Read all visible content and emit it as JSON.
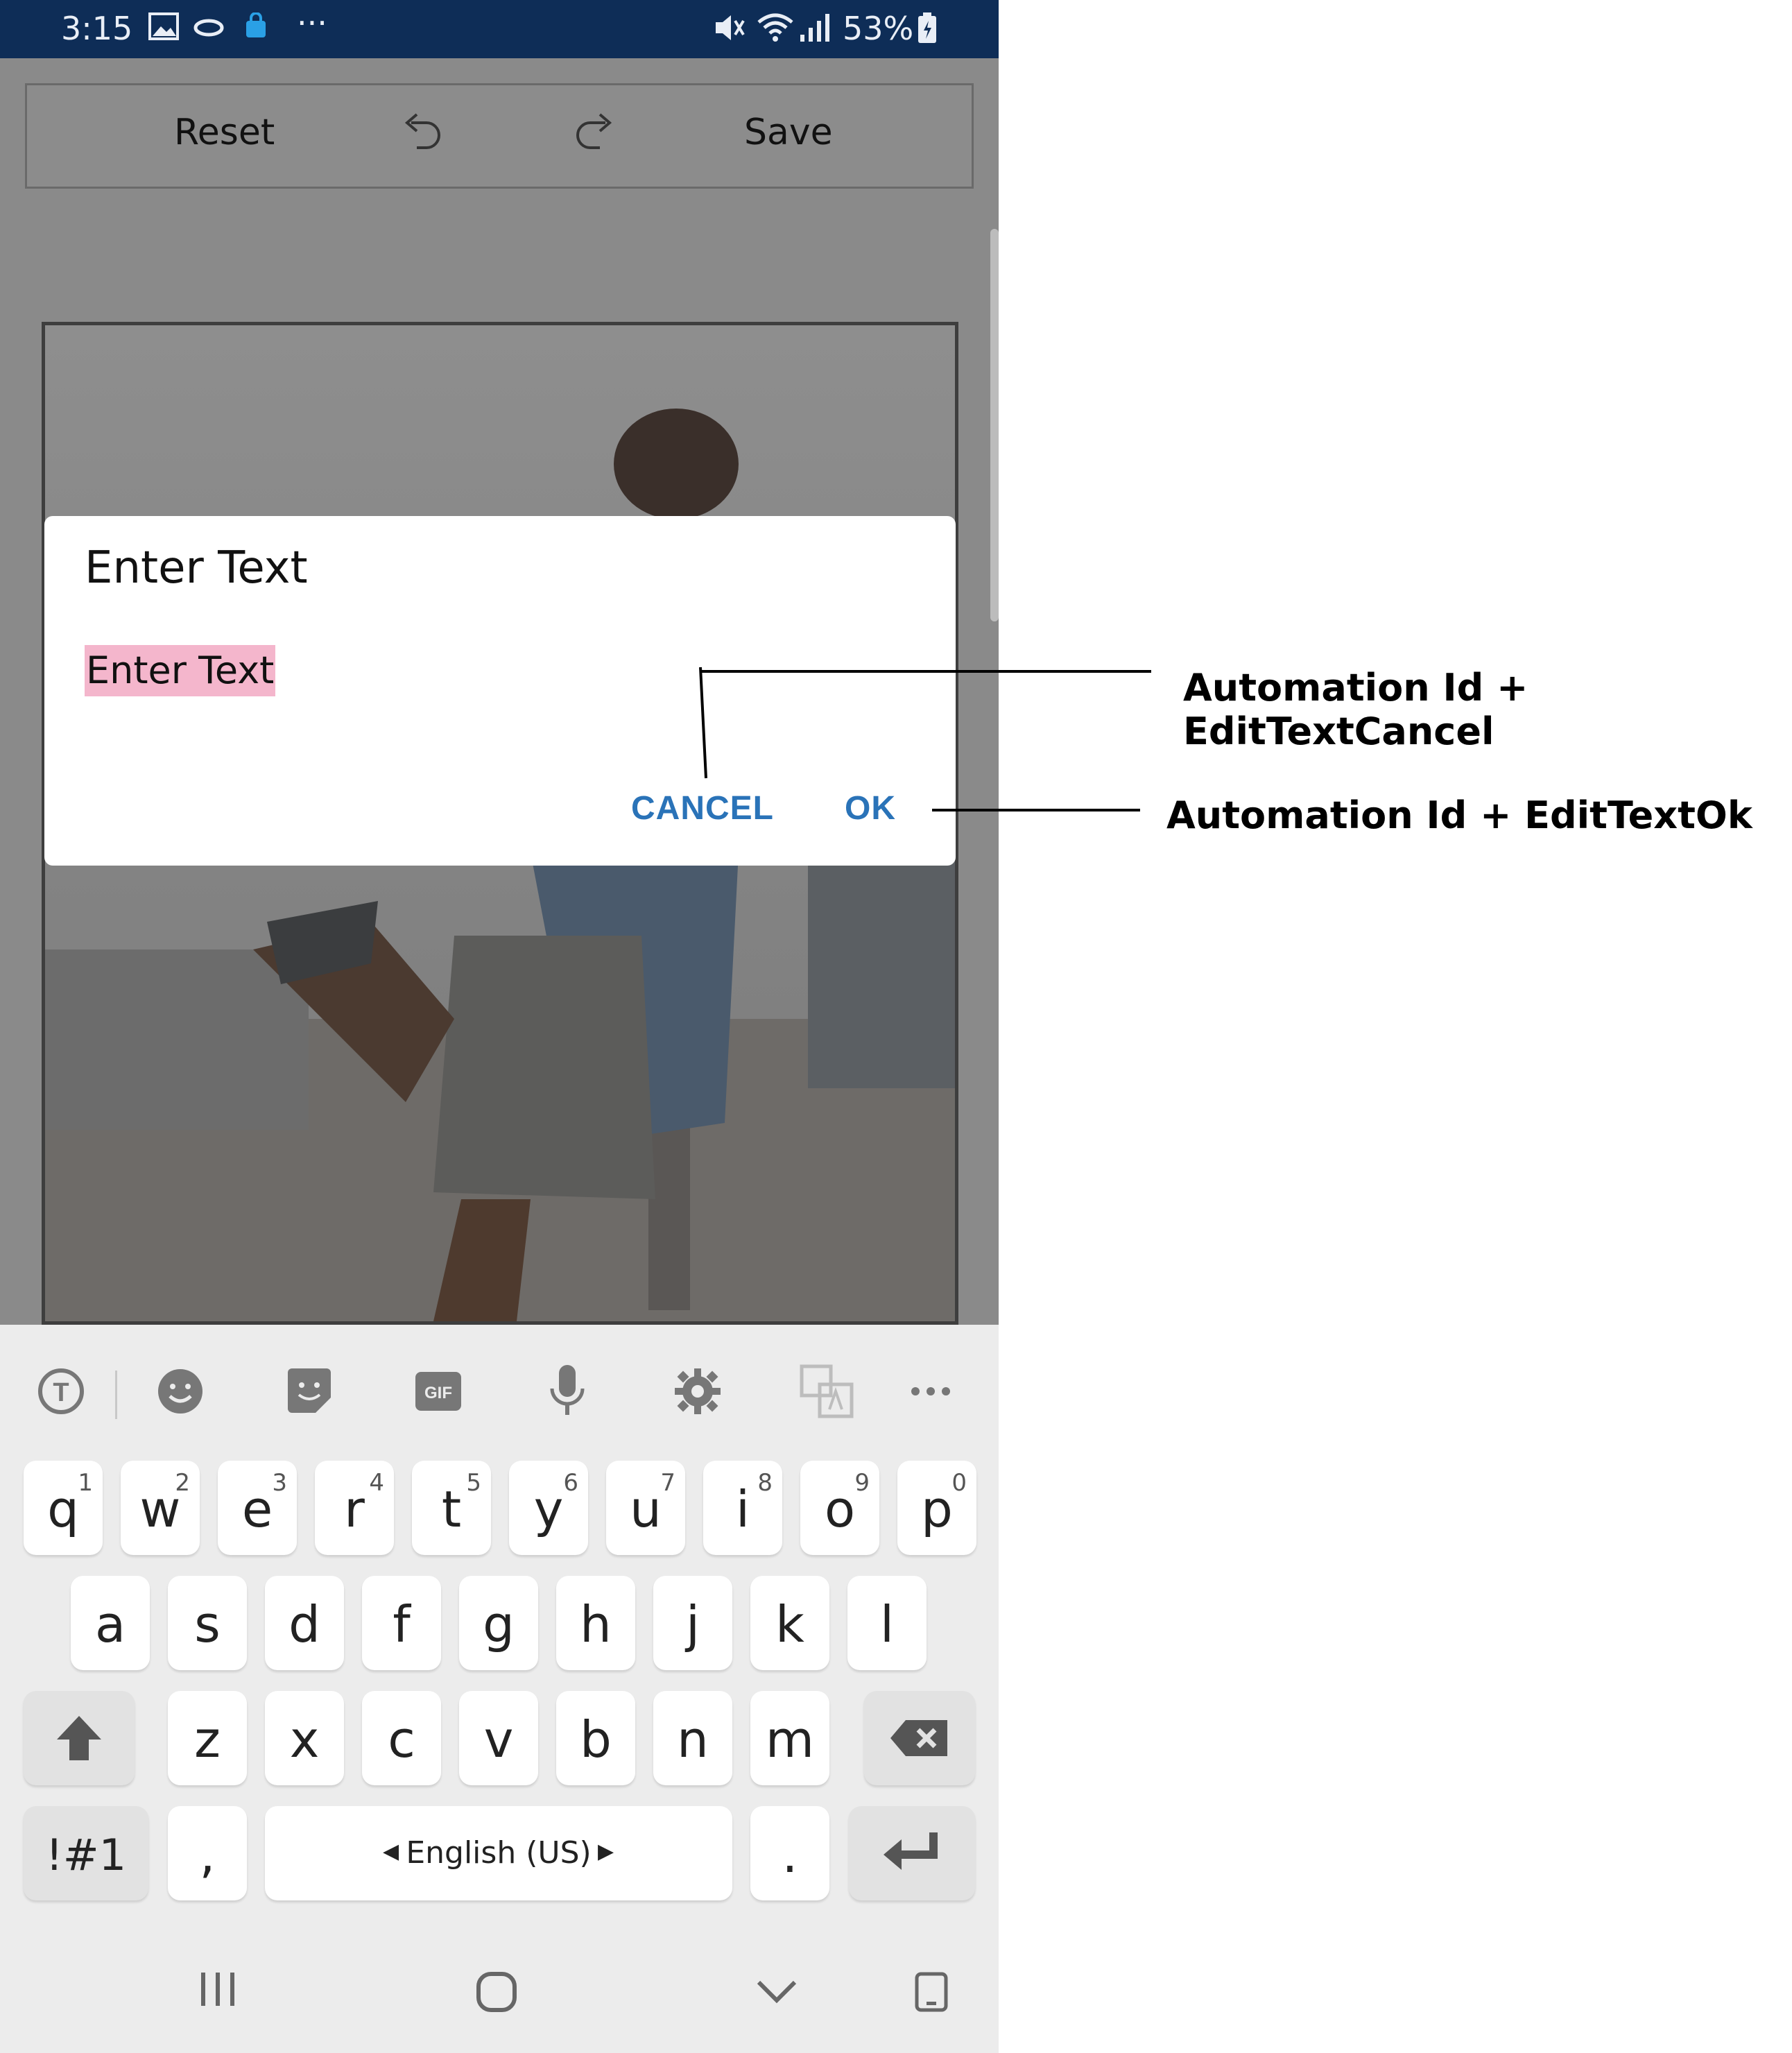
{
  "status_bar": {
    "time": "3:15",
    "more": "···",
    "battery": "53%"
  },
  "toolbar": {
    "reset_label": "Reset",
    "save_label": "Save"
  },
  "dialog": {
    "title": "Enter Text",
    "input_value": "Enter Text",
    "cancel_label": "CANCEL",
    "ok_label": "OK"
  },
  "annotations": {
    "cancel_note": "Automation Id + EditTextCancel",
    "ok_note": "Automation Id + EditTextOk"
  },
  "keyboard": {
    "toolbar_icons": [
      "text-recognition-icon",
      "emoji-icon",
      "sticker-icon",
      "gif-icon",
      "microphone-icon",
      "settings-icon",
      "translate-icon",
      "more-icon"
    ],
    "gif_label": "GIF",
    "row1": [
      {
        "key": "q",
        "num": "1"
      },
      {
        "key": "w",
        "num": "2"
      },
      {
        "key": "e",
        "num": "3"
      },
      {
        "key": "r",
        "num": "4"
      },
      {
        "key": "t",
        "num": "5"
      },
      {
        "key": "y",
        "num": "6"
      },
      {
        "key": "u",
        "num": "7"
      },
      {
        "key": "i",
        "num": "8"
      },
      {
        "key": "o",
        "num": "9"
      },
      {
        "key": "p",
        "num": "0"
      }
    ],
    "row2": [
      "a",
      "s",
      "d",
      "f",
      "g",
      "h",
      "j",
      "k",
      "l"
    ],
    "row3": [
      "z",
      "x",
      "c",
      "v",
      "b",
      "n",
      "m"
    ],
    "symbols_label": "!#1",
    "comma_label": ",",
    "space_label": "English (US)",
    "period_label": "."
  },
  "colors": {
    "status_bar_bg": "#0e2d57",
    "dialog_accent": "#2a73b8",
    "selection_highlight": "#f4b6cc"
  }
}
